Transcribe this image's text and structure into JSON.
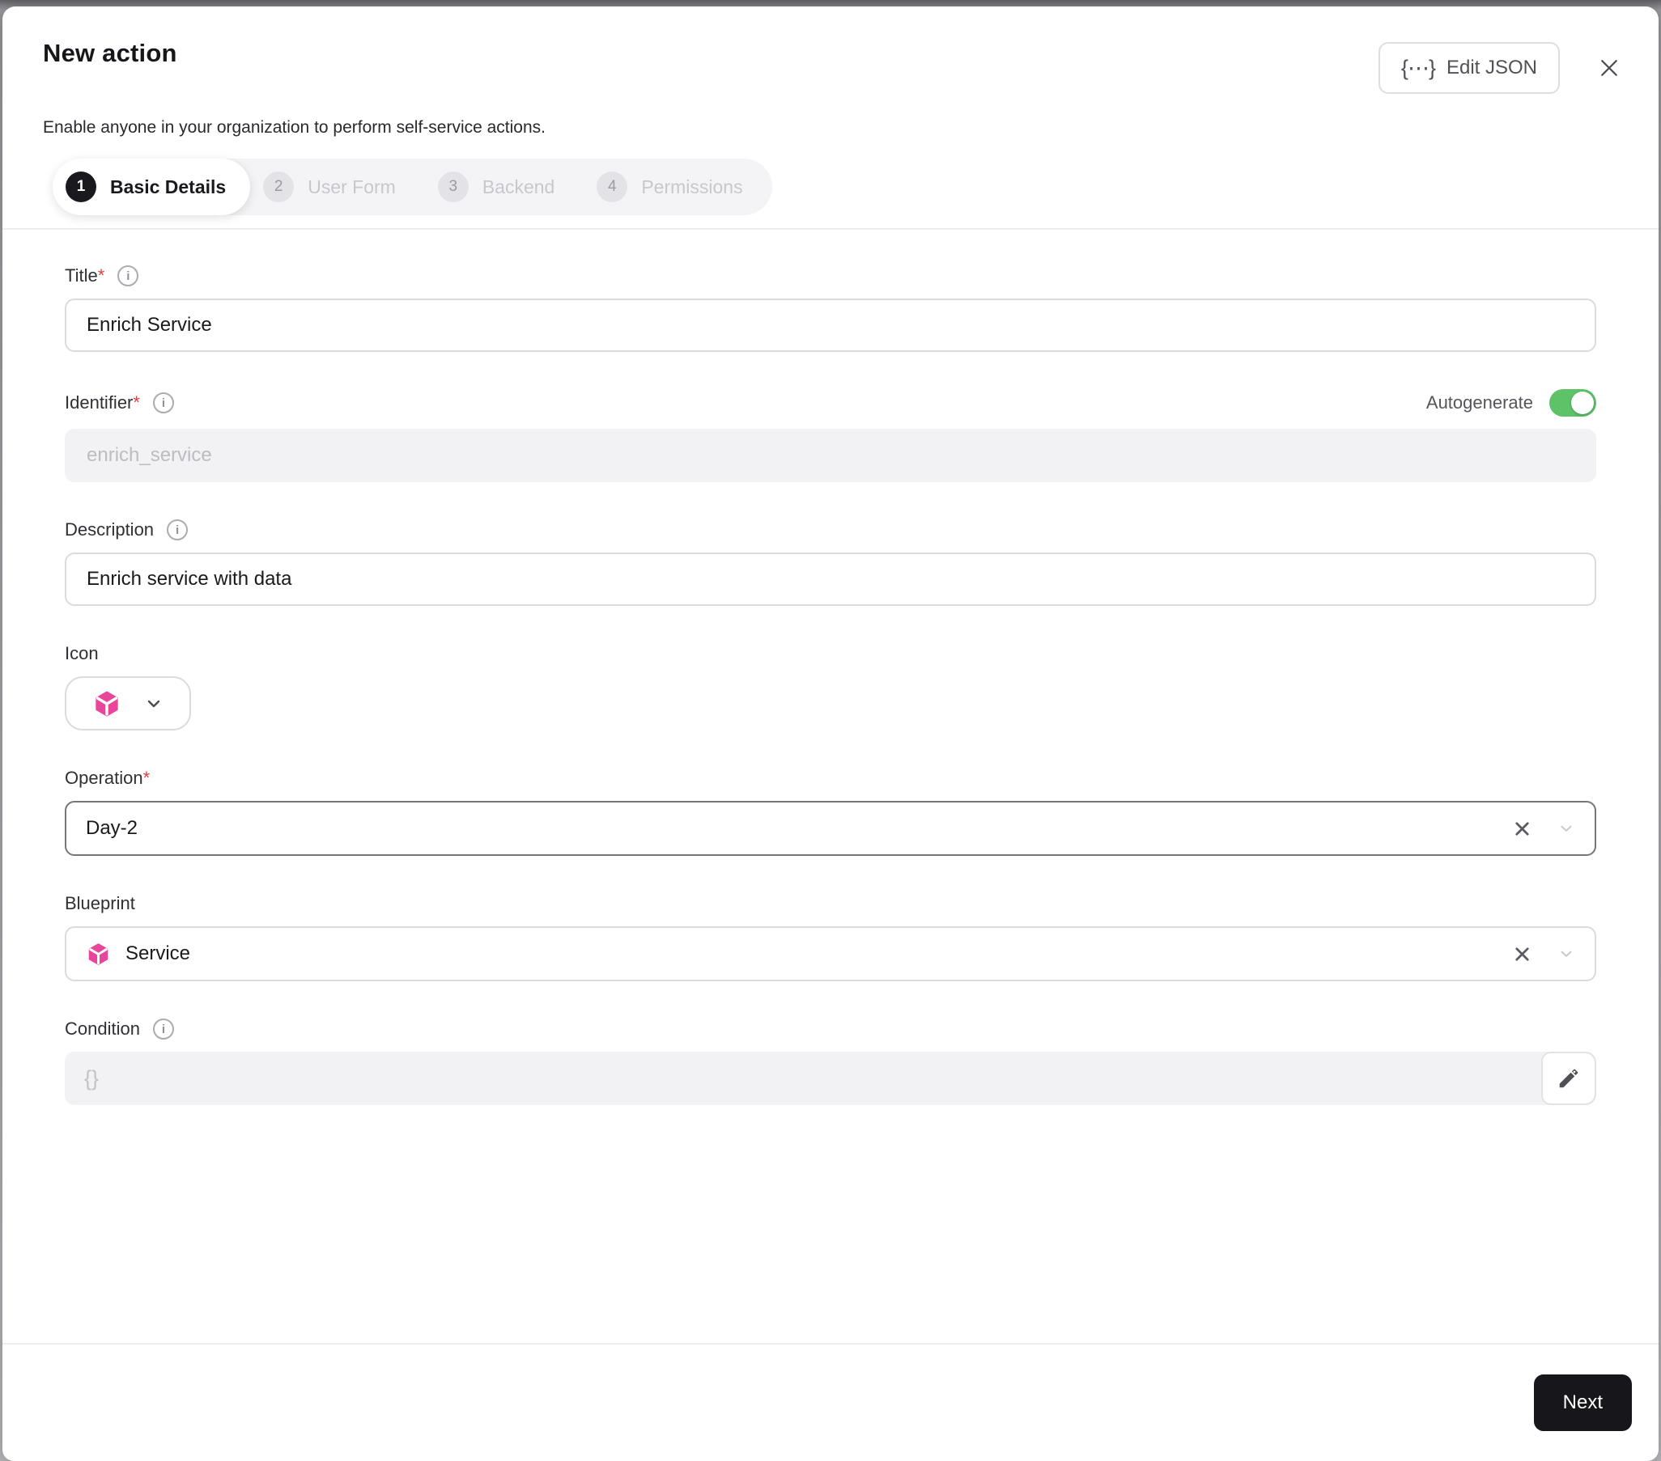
{
  "modal": {
    "title": "New action",
    "subtitle": "Enable anyone in your organization to perform self-service actions.",
    "edit_json_button": "Edit JSON",
    "edit_json_icon": "{⋯}",
    "close_icon": "close"
  },
  "stepper": {
    "steps": [
      {
        "number": "1",
        "label": "Basic Details",
        "state": "active"
      },
      {
        "number": "2",
        "label": "User Form",
        "state": "upcoming"
      },
      {
        "number": "3",
        "label": "Backend",
        "state": "upcoming"
      },
      {
        "number": "4",
        "label": "Permissions",
        "state": "upcoming"
      }
    ]
  },
  "form": {
    "title_field": {
      "label": "Title",
      "required_mark": "*",
      "value": "Enrich Service"
    },
    "identifier_field": {
      "label": "Identifier",
      "required_mark": "*",
      "value": "enrich_service",
      "autogenerate_label": "Autogenerate",
      "autogenerate_state": "on"
    },
    "description_field": {
      "label": "Description",
      "value": "Enrich service with data"
    },
    "icon_field": {
      "label": "Icon",
      "selected_icon": "service-cube"
    },
    "operation_field": {
      "label": "Operation",
      "required_mark": "*",
      "value": "Day-2"
    },
    "blueprint_field": {
      "label": "Blueprint",
      "value": "Service",
      "value_icon": "service-cube"
    },
    "condition_field": {
      "label": "Condition",
      "placeholder": "{}"
    }
  },
  "footer": {
    "next_button": "Next"
  },
  "colors": {
    "brand_pink": "#e8459b",
    "toggle_green": "#5ec269",
    "primary_button_black": "#17171b",
    "required_red": "#e03e3e"
  }
}
